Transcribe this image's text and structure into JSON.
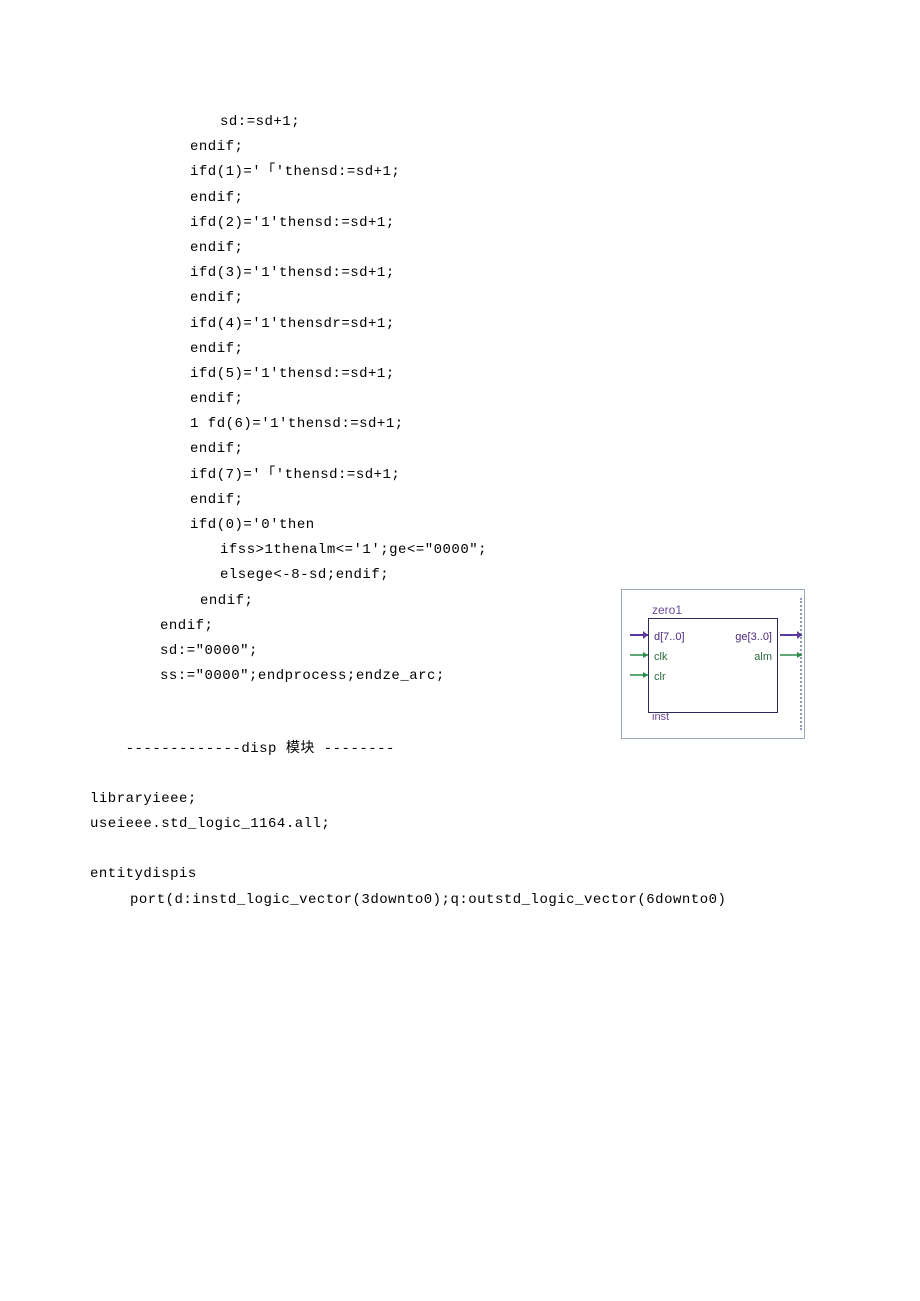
{
  "lines": [
    {
      "cls": "indent-4",
      "text": "sd:=sd+1;"
    },
    {
      "cls": "indent-3",
      "text": "endif;"
    },
    {
      "cls": "indent-3",
      "text": "ifd(1)='「'thensd:=sd+1;"
    },
    {
      "cls": "indent-3",
      "text": "endif;"
    },
    {
      "cls": "indent-3",
      "text": "ifd(2)='1'thensd:=sd+1;"
    },
    {
      "cls": "indent-3",
      "text": "endif;"
    },
    {
      "cls": "indent-3",
      "text": "ifd(3)='1'thensd:=sd+1;"
    },
    {
      "cls": "indent-3",
      "text": "endif;"
    },
    {
      "cls": "indent-3",
      "text": "ifd(4)='1'thensdr=sd+1;"
    },
    {
      "cls": "indent-3",
      "text": "endif;"
    },
    {
      "cls": "indent-3",
      "text": "ifd(5)='1'thensd:=sd+1;"
    },
    {
      "cls": "indent-3",
      "text": "endif;"
    },
    {
      "cls": "indent-3",
      "text": "1 fd(6)='1'thensd:=sd+1;"
    },
    {
      "cls": "indent-3",
      "text": "endif;"
    },
    {
      "cls": "indent-3",
      "text": "ifd(7)='「'thensd:=sd+1;"
    },
    {
      "cls": "indent-3",
      "text": "endif;"
    },
    {
      "cls": "indent-3",
      "text": "ifd(0)='0'then"
    },
    {
      "cls": "indent-4",
      "text": "ifss>1thenalm<='1';ge<=\"0000\";"
    },
    {
      "cls": "indent-4",
      "text": "elsege<-8-sd;endif;"
    },
    {
      "cls": "indent-3b",
      "text": "endif;"
    },
    {
      "cls": "indent-2",
      "text": "endif;"
    },
    {
      "cls": "indent-2",
      "text": "sd:=\"0000\";"
    },
    {
      "cls": "indent-2",
      "text": "ss:=\"0000\";endprocess;endze_arc;"
    }
  ],
  "section": {
    "header_prefix": "-------------disp ",
    "header_cjk": "模块",
    "header_suffix": " --------",
    "lib1": "libraryieee;",
    "lib2": "useieee.std_logic_1164.all;",
    "blank": "",
    "entity": "entitydispis",
    "port": "port(d:instd_logic_vector(3downto0);q:outstd_logic_vector(6downto0)"
  },
  "diagram": {
    "title": "zero1",
    "inst": "inst",
    "left_ports": [
      "d[7..0]",
      "clk",
      "clr"
    ],
    "right_ports": [
      "ge[3..0]",
      "alm"
    ]
  }
}
